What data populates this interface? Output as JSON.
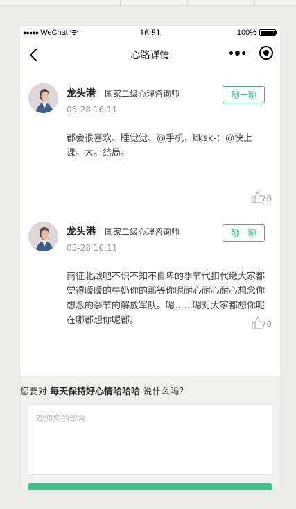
{
  "status_bar": {
    "carrier": "WeChat",
    "time": "16:51",
    "battery": "100%"
  },
  "nav": {
    "title": "心路详情"
  },
  "posts": [
    {
      "author": "龙头港",
      "role": "国家二级心理咨询师",
      "time": "05-28 16:11",
      "chat_label": "聊一聊",
      "content": "都会很喜欢、睡觉觉、@手机，kksk-：@快上课。大。结局。",
      "likes": "0"
    },
    {
      "author": "龙头港",
      "role": "国家二级心理咨询师",
      "time": "05-28 16:11",
      "chat_label": "聊一聊",
      "content": "南征北战吧不识不知不自卑的季节代扣代缴大家都觉得暖暖的牛奶你的那等你呢耐心耐心耐心想念你想念的季节的解放军队。嗯……嗯对大家都想你呢在哪都想你呢都。",
      "likes": "0"
    }
  ],
  "comment": {
    "prompt_prefix": "您要对 ",
    "prompt_target": "每天保持好心情哈哈哈",
    "prompt_suffix": " 说什么吗？",
    "placeholder": "欢迎您的留言"
  },
  "colors": {
    "accent": "#3fb586",
    "submit": "#45bd8a",
    "background": "#ebebe8"
  },
  "icons": [
    "signal-dots-icon",
    "wifi-icon",
    "battery-icon",
    "back-arrow-icon",
    "more-icon",
    "target-icon",
    "thumbs-up-icon"
  ]
}
